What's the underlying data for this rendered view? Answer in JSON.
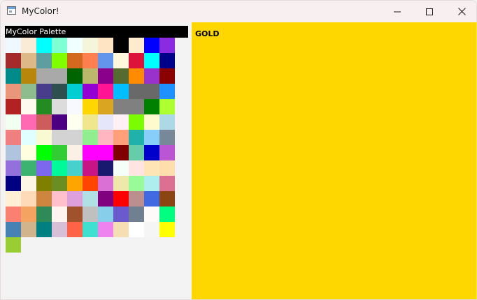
{
  "window": {
    "title": "MyColor!"
  },
  "palette": {
    "title": "MyColor Palette",
    "colors": [
      "#f0f8ff",
      "#faebd7",
      "#00ffff",
      "#7fffd4",
      "#f0ffff",
      "#f5f5dc",
      "#ffe4c4",
      "#000000",
      "#ffebcd",
      "#0000ff",
      "#8a2be2",
      "#a52a2a",
      "#deb887",
      "#5f9ea0",
      "#7fff00",
      "#d2691e",
      "#ff7f50",
      "#6495ed",
      "#fff8dc",
      "#dc143c",
      "#00ffff",
      "#00008b",
      "#008b8b",
      "#b8860b",
      "#a9a9a9",
      "#a9a9a9",
      "#006400",
      "#bdb76b",
      "#8b008b",
      "#556b2f",
      "#ff8c00",
      "#9932cc",
      "#8b0000",
      "#e9967a",
      "#8fbc8f",
      "#483d8b",
      "#2f4f4f",
      "#00ced1",
      "#9400d3",
      "#ff1493",
      "#00bfff",
      "#696969",
      "#696969",
      "#1e90ff",
      "#b22222",
      "#fffaf0",
      "#228b22",
      "#dcdcdc",
      "#f8f8ff",
      "#ffd700",
      "#daa520",
      "#808080",
      "#808080",
      "#008000",
      "#adff2f",
      "#f0fff0",
      "#ff69b4",
      "#cd5c5c",
      "#4b0082",
      "#fffff0",
      "#f0e68c",
      "#e6e6fa",
      "#fff0f5",
      "#7cfc00",
      "#fffacd",
      "#add8e6",
      "#f08080",
      "#e0ffff",
      "#fafad2",
      "#d3d3d3",
      "#d3d3d3",
      "#90ee90",
      "#ffb6c1",
      "#ffa07a",
      "#20b2aa",
      "#87cefa",
      "#778899",
      "#b0c4de",
      "#ffffe0",
      "#00ff00",
      "#32cd32",
      "#faf0e6",
      "#ff00ff",
      "#ff00ff",
      "#800000",
      "#66cdaa",
      "#0000cd",
      "#ba55d3",
      "#9370db",
      "#3cb371",
      "#7b68ee",
      "#00fa9a",
      "#48d1cc",
      "#c71585",
      "#191970",
      "#f5fffa",
      "#ffe4e1",
      "#ffe4b5",
      "#ffdead",
      "#000080",
      "#fdf5e6",
      "#808000",
      "#6b8e23",
      "#ffa500",
      "#ff4500",
      "#da70d6",
      "#eee8aa",
      "#98fb98",
      "#afeeee",
      "#db7093",
      "#ffefd5",
      "#ffdab9",
      "#cd853f",
      "#ffc0cb",
      "#dda0dd",
      "#b0e0e6",
      "#800080",
      "#ff0000",
      "#bc8f8f",
      "#4169e1",
      "#8b4513",
      "#fa8072",
      "#f4a460",
      "#2e8b57",
      "#fff5ee",
      "#a0522d",
      "#c0c0c0",
      "#87ceeb",
      "#6a5acd",
      "#708090",
      "#fffafa",
      "#00ff7f",
      "#4682b4",
      "#d2b48c",
      "#008080",
      "#d8bfd8",
      "#ff6347",
      "#40e0d0",
      "#ee82ee",
      "#f5deb3",
      "#ffffff",
      "#f5f5f5",
      "#ffff00",
      "#9acd32"
    ]
  },
  "preview": {
    "label": "GOLD",
    "color": "#ffd700"
  }
}
